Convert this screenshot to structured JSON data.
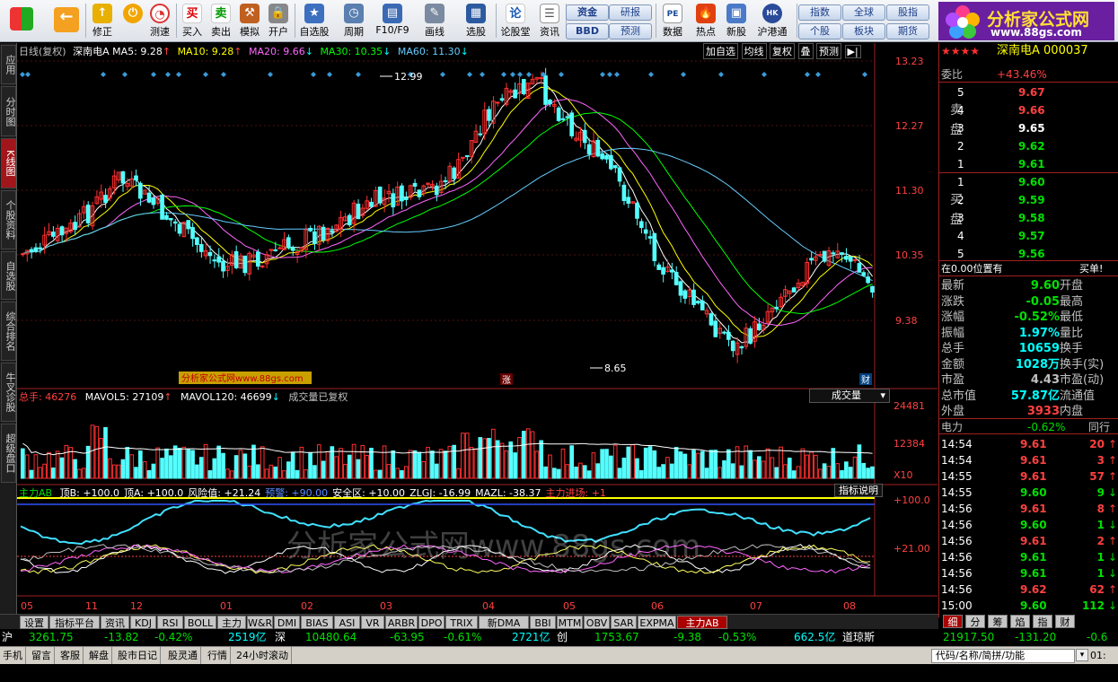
{
  "toolbar": {
    "buttons": [
      {
        "label": "",
        "name": "back"
      },
      {
        "label": "修正",
        "name": "modify"
      },
      {
        "label": "测速",
        "name": "speedtest"
      },
      {
        "label": "买入",
        "name": "buy"
      },
      {
        "label": "卖出",
        "name": "sell"
      },
      {
        "label": "模拟",
        "name": "simulate"
      },
      {
        "label": "开户",
        "name": "open-account"
      },
      {
        "label": "自选股",
        "name": "watchlist"
      },
      {
        "label": "周期",
        "name": "period"
      },
      {
        "label": "F10/F9",
        "name": "f10"
      },
      {
        "label": "画线",
        "name": "draw-line"
      },
      {
        "label": "选股",
        "name": "stock-picker"
      },
      {
        "label": "论股堂",
        "name": "forum"
      },
      {
        "label": "资讯",
        "name": "news"
      },
      {
        "label": "数据",
        "name": "data"
      },
      {
        "label": "热点",
        "name": "hotspot"
      },
      {
        "label": "新股",
        "name": "new-stock"
      },
      {
        "label": "沪港通",
        "name": "hk-connect"
      }
    ],
    "blue_buttons": [
      "资金",
      "BBD",
      "研报",
      "预测",
      "指数",
      "个股",
      "全球",
      "板块",
      "股指",
      "期货"
    ],
    "logo_title": "分析家公式网",
    "logo_url": "www.88gs.com"
  },
  "left_tabs": [
    "应用",
    "分时图",
    "K线图",
    "个股资料",
    "自选股",
    "综合排名",
    "牛叉诊股",
    "超级盘口"
  ],
  "kchart": {
    "header_period": "日线(复权)",
    "header_name": "深南电A",
    "ma5": "MA5: 9.28",
    "ma10": "MA10: 9.28",
    "ma20": "MA20: 9.66",
    "ma30": "MA30: 10.35",
    "ma60": "MA60: 11.30",
    "buttons": [
      "加自选",
      "均线",
      "复权",
      "叠",
      "预测"
    ],
    "y_ticks": [
      "13.23",
      "12.27",
      "11.30",
      "10.35",
      "9.38"
    ],
    "high_label": "12.99",
    "low_label": "8.65",
    "watermark_label": "分析家公式网www.88gs.com",
    "zhang_label": "涨",
    "cai_label": "财"
  },
  "volume": {
    "total": "总手: 46276",
    "mavol5": "MAVOL5: 27109",
    "mavol120": "MAVOL120: 46699",
    "note": "成交量已复权",
    "selector": "成交量",
    "y_ticks": [
      "24481",
      "12384"
    ],
    "unit": "X10"
  },
  "indicator": {
    "name": "主力AB",
    "items": [
      {
        "text": "顶B: +100.0",
        "color": "#ffffff"
      },
      {
        "text": "顶A: +100.0",
        "color": "#ffffff"
      },
      {
        "text": "风险值: +21.24",
        "color": "#ffffff"
      },
      {
        "text": "预警: +90.00",
        "color": "#5b8cff"
      },
      {
        "text": "安全区: +10.00",
        "color": "#ffffff"
      },
      {
        "text": "ZLGJ: -16.99",
        "color": "#ffffff"
      },
      {
        "text": "MAZL: -38.37",
        "color": "#ffffff"
      },
      {
        "text": "主力进场: +1",
        "color": "#ff4040"
      }
    ],
    "help_button": "指标说明",
    "y_ticks": [
      "+100.0",
      "+21.00"
    ],
    "watermark": "分析家公式网www.88gs.com",
    "buy_label": "买"
  },
  "x_axis": [
    "05",
    "11",
    "12",
    "01",
    "02",
    "03",
    "04",
    "05",
    "06",
    "07",
    "08"
  ],
  "bottom_tabs": [
    "设置",
    "指标平台",
    "资讯",
    "KDJ",
    "RSI",
    "BOLL",
    "主力",
    "W&R",
    "DMI",
    "BIAS",
    "ASI",
    "VR",
    "ARBR",
    "DPO",
    "TRIX",
    "新DMA",
    "BBI",
    "MTM",
    "OBV",
    "SAR",
    "EXPMA",
    "主力AB"
  ],
  "right_panel": {
    "title": "深南电A 000037",
    "weibi_label": "委比",
    "weibi_value": "+43.46%",
    "sell_label": "卖盘",
    "buy_label": "买盘",
    "sell_orders": [
      {
        "level": "5",
        "price": "9.67"
      },
      {
        "level": "4",
        "price": "9.66"
      },
      {
        "level": "3",
        "price": "9.65"
      },
      {
        "level": "2",
        "price": "9.62"
      },
      {
        "level": "1",
        "price": "9.61"
      }
    ],
    "buy_orders": [
      {
        "level": "1",
        "price": "9.60"
      },
      {
        "level": "2",
        "price": "9.59"
      },
      {
        "level": "3",
        "price": "9.58"
      },
      {
        "level": "4",
        "price": "9.57"
      },
      {
        "level": "5",
        "price": "9.56"
      }
    ],
    "position_text": "在0.00位置有",
    "position_right": "买单!",
    "stats": [
      {
        "l": "最新",
        "v": "9.60",
        "r": "开盘",
        "c": "#00e000"
      },
      {
        "l": "涨跌",
        "v": "-0.05",
        "r": "最高",
        "c": "#00e000"
      },
      {
        "l": "涨幅",
        "v": "-0.52%",
        "r": "最低",
        "c": "#00e000"
      },
      {
        "l": "振幅",
        "v": "1.97%",
        "r": "量比",
        "c": "#00ffff"
      },
      {
        "l": "总手",
        "v": "10659",
        "r": "换手",
        "c": "#00ffff"
      },
      {
        "l": "金额",
        "v": "1028万",
        "r": "换手(实)",
        "c": "#00ffff"
      },
      {
        "l": "市盈",
        "v": "4.43",
        "r": "市盈(动)",
        "c": "#c0c0c0"
      },
      {
        "l": "总市值",
        "v": "57.87亿",
        "r": "流通值",
        "c": "#00ffff"
      },
      {
        "l": "外盘",
        "v": "3933",
        "r": "内盘",
        "c": "#ff4040"
      }
    ],
    "sector_name": "电力",
    "sector_change": "-0.62%",
    "sector_right": "同行",
    "ticks": [
      {
        "t": "14:54",
        "p": "9.61",
        "v": "20",
        "c": "#ff4040"
      },
      {
        "t": "14:54",
        "p": "9.61",
        "v": "3",
        "c": "#ff4040"
      },
      {
        "t": "14:55",
        "p": "9.61",
        "v": "57",
        "c": "#ff4040"
      },
      {
        "t": "14:55",
        "p": "9.60",
        "v": "9",
        "c": "#00e000"
      },
      {
        "t": "14:56",
        "p": "9.61",
        "v": "8",
        "c": "#ff4040"
      },
      {
        "t": "14:56",
        "p": "9.60",
        "v": "1",
        "c": "#00e000"
      },
      {
        "t": "14:56",
        "p": "9.61",
        "v": "2",
        "c": "#ff4040"
      },
      {
        "t": "14:56",
        "p": "9.61",
        "v": "1",
        "c": "#00e000"
      },
      {
        "t": "14:56",
        "p": "9.61",
        "v": "1",
        "c": "#00e000"
      },
      {
        "t": "14:56",
        "p": "9.62",
        "v": "62",
        "c": "#ff4040"
      },
      {
        "t": "15:00",
        "p": "9.60",
        "v": "112",
        "c": "#00e000"
      }
    ],
    "bottom_tabs": [
      "细",
      "分",
      "筹",
      "焰",
      "指",
      "财"
    ]
  },
  "ticker": {
    "sh_label": "沪",
    "sh_index": "3261.75",
    "sh_change": "-13.82",
    "sh_pct": "-0.42%",
    "sh_amount": "2519亿",
    "sz_label": "深",
    "sz_index": "10480.64",
    "sz_change": "-63.95",
    "sz_pct": "-0.61%",
    "sz_amount": "2721亿",
    "cy_label": "创",
    "cy_index": "1753.67",
    "cy_change": "-9.38",
    "cy_pct": "-0.53%",
    "cy_amount": "662.5亿",
    "dj_label": "道琼斯",
    "dj_index": "21917.50",
    "dj_change": "-131.20",
    "dj_pct": "-0.6"
  },
  "statusbar": {
    "items": [
      "手机",
      "留言",
      "客服",
      "解盘",
      "股市日记",
      "股灵通",
      "行情",
      "24小时滚动"
    ],
    "search_placeholder": "代码/名称/简拼/功能",
    "clock": "01:"
  },
  "colors": {
    "ma5": "#ffffff",
    "ma10": "#ffff00",
    "ma20": "#ff66ff",
    "ma30": "#00ff00",
    "ma60": "#66ccff",
    "up": "#ff3030",
    "down": "#54ffff"
  }
}
